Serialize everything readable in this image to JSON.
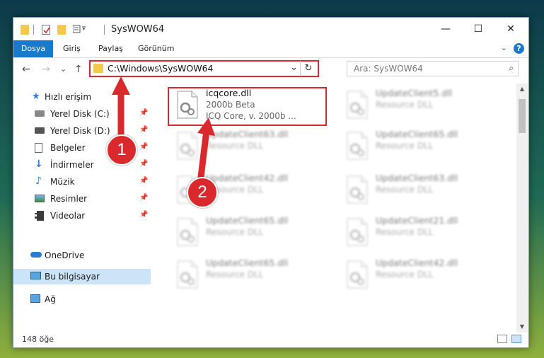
{
  "window": {
    "title": "SysWOW64",
    "controls": {
      "minimize": "—",
      "maximize": "☐",
      "close": "✕"
    }
  },
  "ribbon": {
    "tabs": [
      "Dosya",
      "Giriş",
      "Paylaş",
      "Görünüm"
    ],
    "collapse_glyph": "⌄",
    "help_glyph": "?"
  },
  "navbar": {
    "back": "←",
    "forward": "→",
    "recent": "⌄",
    "up": "↑",
    "address": "C:\\Windows\\SysWOW64",
    "address_dropdown": "⌄",
    "refresh": "↻",
    "search_placeholder": "Ara: SysWOW64",
    "search_glyph": "⌕"
  },
  "navpane": {
    "quick_access": "Hızlı erişim",
    "items": [
      {
        "label": "Yerel Disk (C:)",
        "icon": "drive-icon"
      },
      {
        "label": "Yerel Disk (D:)",
        "icon": "drive-icon"
      },
      {
        "label": "Belgeler",
        "icon": "documents-icon"
      },
      {
        "label": "İndirmeler",
        "icon": "downloads-icon"
      },
      {
        "label": "Müzik",
        "icon": "music-icon"
      },
      {
        "label": "Resimler",
        "icon": "pictures-icon"
      },
      {
        "label": "Videolar",
        "icon": "videos-icon"
      }
    ],
    "onedrive": "OneDrive",
    "this_pc": "Bu bilgisayar",
    "network": "Ağ",
    "pin_glyph": "📌"
  },
  "files": [
    {
      "name": "icqcore.dll",
      "type": "2000b Beta",
      "desc": "ICQ Core, v. 2000b ...",
      "highlight": true
    },
    {
      "name": "UpdateClient5.dll",
      "type": "Resource DLL"
    },
    {
      "name": "UpdateClient63.dll",
      "type": "Resource DLL"
    },
    {
      "name": "UpdateClient65.dll",
      "type": "Resource DLL"
    },
    {
      "name": "UpdateClient42.dll",
      "type": "Resource DLL"
    },
    {
      "name": "UpdateClient63.dll",
      "type": "Resource DLL"
    },
    {
      "name": "UpdateClient65.dll",
      "type": "Resource DLL"
    },
    {
      "name": "UpdateClient21.dll",
      "type": "Resource DLL"
    },
    {
      "name": "UpdateClient65.dll",
      "type": "Resource DLL"
    },
    {
      "name": "UpdateClient42.dll",
      "type": "Resource DLL"
    }
  ],
  "status": {
    "count": "148 öğe"
  },
  "annotations": {
    "step1": "1",
    "step2": "2",
    "color": "#d9292c"
  },
  "colors": {
    "accent": "#1979ca",
    "highlight": "#d9292c",
    "selected": "#cce4f7"
  }
}
